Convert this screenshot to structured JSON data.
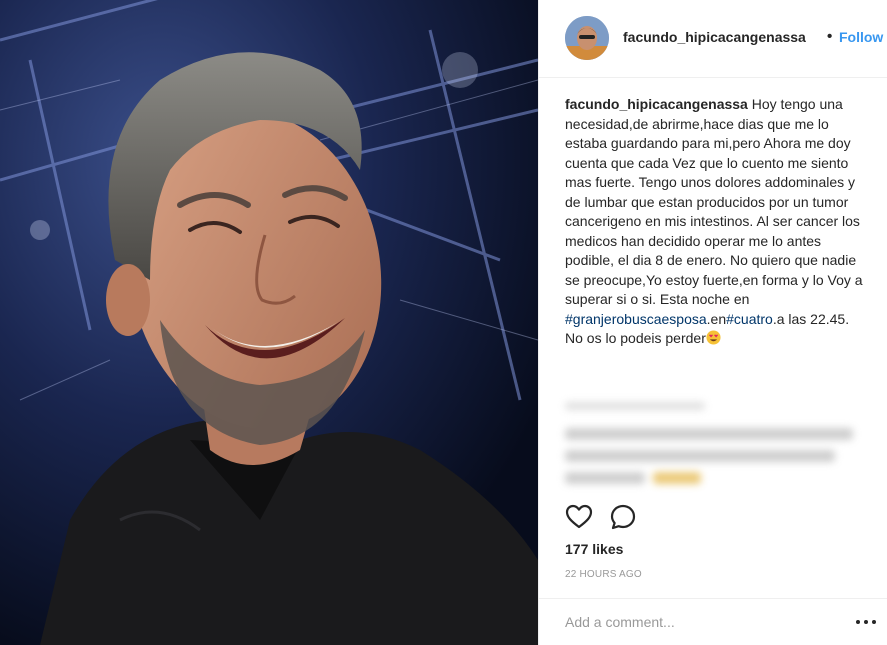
{
  "post": {
    "username": "facundo_hipicacangenassa",
    "separator": "•",
    "follow_label": "Follow",
    "caption": {
      "username": "facundo_hipicacangenassa",
      "text_before": " Hoy tengo una necesidad,de abrirme,hace dias que me lo estaba guardando para mi,pero Ahora me doy cuenta que cada Vez que lo cuento me siento mas fuerte. Tengo unos dolores addominales y de lumbar que estan producidos por un tumor cancerigeno en mis intestinos. Al ser cancer los medicos han decidido operar me lo antes podible, el dia 8 de enero. No quiero que nadie se preocupe,Yo estoy fuerte,en forma y lo Voy a superar si o si. Esta noche en ",
      "hashtag1": "#granjerobuscaesposa",
      "middle": ".en",
      "hashtag2": "#cuatro",
      "text_after": ".a las 22.45. No os lo podeis perder",
      "emoji": "heart-eyes-emoji"
    },
    "likes": "177 likes",
    "timestamp": "22 HOURS AGO",
    "comment_placeholder": "Add a comment..."
  },
  "icons": {
    "like": "heart-icon",
    "comment": "comment-bubble-icon",
    "more": "more-options-icon"
  },
  "colors": {
    "link": "#3897f0",
    "hashtag": "#003569",
    "muted": "#999999",
    "text": "#262626"
  }
}
